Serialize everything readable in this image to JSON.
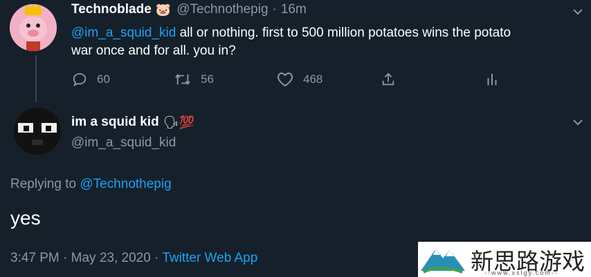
{
  "parent_tweet": {
    "display_name": "Technoblade",
    "name_emoji": "🐷",
    "handle": "@Technothepig",
    "separator": "·",
    "time_ago": "16m",
    "mention": "@im_a_squid_kid",
    "text_line1": "all or nothing. first to 500 million potatoes wins the potato",
    "text_line2": "war once and for all. you in?",
    "reply_count": "60",
    "retweet_count": "56",
    "like_count": "468"
  },
  "reply_tweet": {
    "display_name": "im a squid kid",
    "name_emoji": "🗣💯",
    "handle": "@im_a_squid_kid",
    "replying_to_label": "Replying to",
    "replying_to_handle": "@Technothepig",
    "text": "yes",
    "timestamp": "3:47 PM · May 23, 2020 ·",
    "source": "Twitter Web App"
  },
  "watermark": {
    "title": "新思路游戏",
    "url": "--www.xslgy.com--"
  },
  "colors": {
    "background": "#15202b",
    "muted": "#8899a6",
    "link": "#1da1f2",
    "divider": "#38444d"
  }
}
